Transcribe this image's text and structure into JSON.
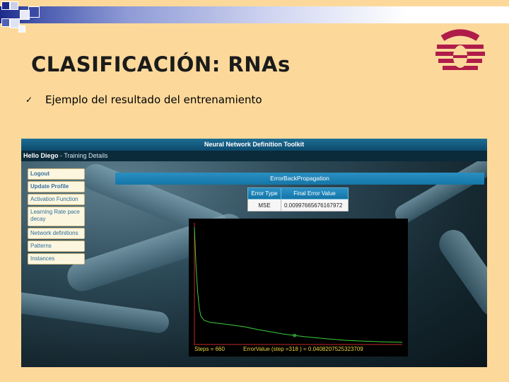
{
  "slide": {
    "title": "CLASIFICACIÓN: RNAs",
    "bullet_icon": "check-mark-icon",
    "bullet": "Ejemplo del resultado del entrenamiento"
  },
  "app": {
    "header_title": "Neural Network Definition Toolkit",
    "greeting": "Hello Diego",
    "section": " - Training Details",
    "menu": [
      {
        "label": "Logout"
      },
      {
        "label": "Update Profile"
      },
      {
        "label": "Activation Function"
      },
      {
        "label": "Learning Rate pace decay"
      },
      {
        "label": "Network definitions"
      },
      {
        "label": "Patterns"
      },
      {
        "label": "Instances"
      }
    ],
    "algorithm_title": "ErrorBackPropagation",
    "table": {
      "headers": [
        "Error Type",
        "Final Error Value"
      ],
      "rows": [
        [
          "MSE",
          "0.00997665676167972"
        ]
      ]
    },
    "plot": {
      "steps_label": "Steps = 660",
      "error_label": "ErrorValue (step =318 ) = 0.0408207525323709"
    }
  },
  "colors": {
    "background": "#fcd99b",
    "accent_blue": "#1576a8",
    "curve": "#3ccd3c",
    "axis": "#c62828",
    "plot_text": "#e8d23a",
    "logo": "#b01c49"
  },
  "chart_data": {
    "type": "line",
    "title": "",
    "xlabel": "",
    "ylabel": "",
    "series": [
      {
        "x": [
          0,
          5,
          10,
          15,
          20,
          30,
          50,
          80,
          120,
          160,
          200,
          240,
          280,
          318,
          360,
          420,
          480,
          540,
          600,
          660
        ],
        "values": [
          0.53,
          0.36,
          0.24,
          0.17,
          0.13,
          0.11,
          0.1,
          0.095,
          0.088,
          0.08,
          0.068,
          0.058,
          0.048,
          0.0408,
          0.034,
          0.026,
          0.019,
          0.015,
          0.012,
          0.01
        ]
      }
    ],
    "xlim": [
      0,
      660
    ],
    "ylim": [
      0,
      0.55
    ],
    "marker": {
      "x": 318,
      "y": 0.0408
    },
    "grid": false,
    "legend": "none"
  }
}
